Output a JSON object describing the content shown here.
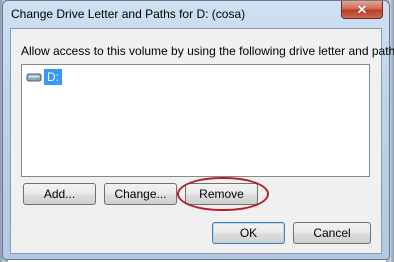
{
  "window": {
    "title": "Change Drive Letter and Paths for D: (cosa)",
    "close_glyph": "✕",
    "close_icon": "close-icon"
  },
  "dialog": {
    "instruction": "Allow access to this volume by using the following drive letter and paths:",
    "list": {
      "items": [
        {
          "label": "D:",
          "icon": "drive-icon",
          "selected": true
        }
      ]
    },
    "buttons": {
      "add": "Add...",
      "change": "Change...",
      "remove": "Remove",
      "ok": "OK",
      "cancel": "Cancel"
    }
  },
  "colors": {
    "selection": "#3399ff",
    "highlight_ring": "#b21f2a",
    "close_button": "#c9503a"
  }
}
